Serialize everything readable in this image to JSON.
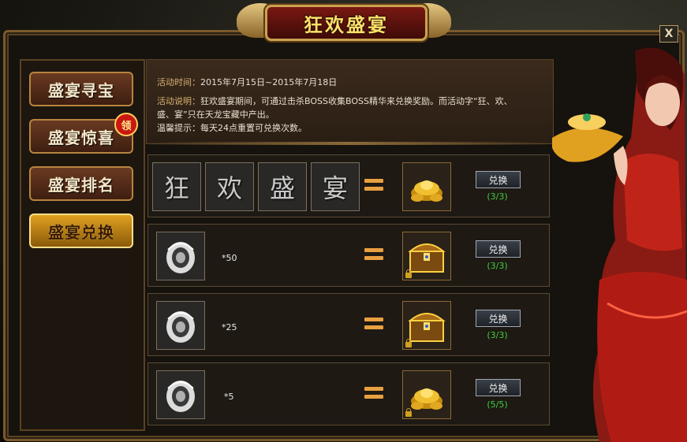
{
  "title": "狂欢盛宴",
  "close_label": "X",
  "tabs": [
    {
      "label": "盛宴寻宝"
    },
    {
      "label": "盛宴惊喜",
      "badge": "领"
    },
    {
      "label": "盛宴排名"
    },
    {
      "label": "盛宴兑换",
      "active": true
    }
  ],
  "info": {
    "time_label": "活动时间：",
    "time_value": "2015年7月15日~2015年7月18日",
    "desc_label": "活动说明：",
    "desc_line1": "狂欢盛宴期间，可通过击杀BOSS收集BOSS精华来兑换奖励。而活动字“狂、欢、",
    "desc_line2": "盛、宴”只在天龙宝藏中产出。",
    "tip": "温馨提示：每天24点重置可兑换次数。"
  },
  "exchange_rows": [
    {
      "chars": [
        "狂",
        "欢",
        "盛",
        "宴"
      ],
      "reward_icon": "gold-ingot-icon",
      "button": "兑换",
      "times": "(3/3)"
    },
    {
      "material_icon": "boss-essence-icon",
      "count": "*50",
      "reward_icon": "treasure-chest-icon",
      "button": "兑换",
      "times": "(3/3)"
    },
    {
      "material_icon": "boss-essence-icon",
      "count": "*25",
      "reward_icon": "treasure-chest-icon",
      "button": "兑换",
      "times": "(3/3)"
    },
    {
      "material_icon": "boss-essence-icon",
      "count": "*5",
      "reward_icon": "gold-ingot-icon",
      "button": "兑换",
      "times": "(5/5)"
    }
  ],
  "colors": {
    "accent_gold": "#ffe06a",
    "times_green": "#40d040",
    "active_tab": "#e0a020"
  }
}
